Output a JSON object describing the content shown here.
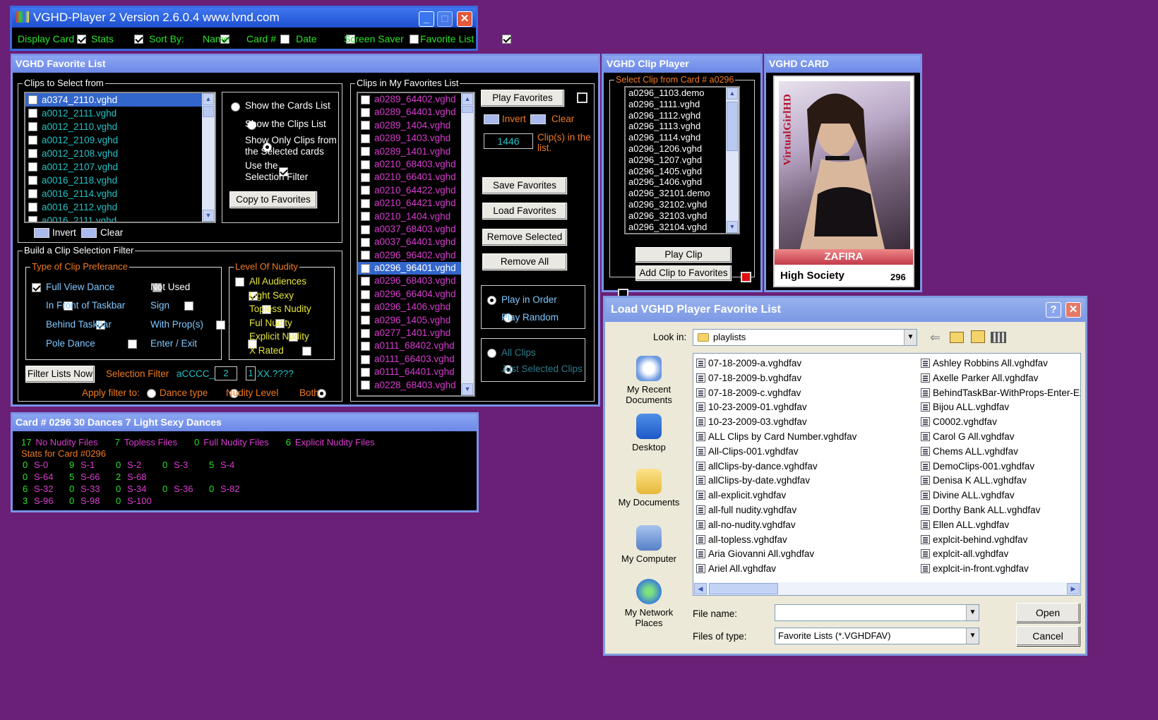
{
  "main_window": {
    "title": "VGHD-Player 2  Version 2.6.0.4  www.lvnd.com",
    "toolbar": {
      "display_card": "Display Card",
      "stats": "Stats",
      "sort_by": "Sort By:",
      "name": "Name",
      "card": "Card #",
      "date": "Date",
      "screen_saver": "Screen Saver",
      "favorite_list": "Favorite List"
    }
  },
  "favorites": {
    "title": "VGHD Favorite List",
    "clips_group": "Clips to Select from",
    "clips": [
      "a0374_2110.vghd",
      "a0012_2111.vghd",
      "a0012_2110.vghd",
      "a0012_2109.vghd",
      "a0012_2108.vghd",
      "a0012_2107.vghd",
      "a0016_2118.vghd",
      "a0016_2114.vghd",
      "a0016_2112.vghd",
      "a0016_2111.vghd"
    ],
    "radio_cards": "Show the Cards List",
    "radio_clips": "Show the Clips List",
    "radio_only_1": "Show Only Clips from",
    "radio_only_2": "the Selected cards",
    "use_1": "Use the",
    "use_2": "Selection Filter",
    "copy_btn": "Copy to Favorites",
    "invert": "Invert",
    "clear": "Clear",
    "filter_group": "Build a Clip Selection Filter",
    "type_group": "Type of Clip Preferance",
    "types": {
      "full_view": "Full View Dance",
      "not_used": "Not Used",
      "in_front": "In Front of Taskbar",
      "sign": "Sign",
      "behind": "Behind Taskbar",
      "with_props": "With Prop(s)",
      "pole": "Pole Dance",
      "enter_exit": "Enter / Exit"
    },
    "nudity_group": "Level Of Nudity",
    "nudity": [
      "All Audiences",
      "Light Sexy",
      "Topless Nudity",
      "Ful Nudity",
      "Explicit Nudity",
      "X Rated"
    ],
    "filter_now": "Filter Lists Now",
    "sel_filter": "Selection Filter",
    "filter_value": "aCCCC_",
    "filter_box1": "2",
    "filter_box2": "1",
    "filter_suffix": "XX.????",
    "apply_to": "Apply filter to:",
    "dance_type": "Dance type",
    "nudity_level": "Nudity Level",
    "both": "Both",
    "fav_group": "Clips in My Favorites List",
    "favs": [
      "a0289_64402.vghd",
      "a0289_64401.vghd",
      "a0289_1404.vghd",
      "a0289_1403.vghd",
      "a0289_1401.vghd",
      "a0210_68403.vghd",
      "a0210_66401.vghd",
      "a0210_64422.vghd",
      "a0210_64421.vghd",
      "a0210_1404.vghd",
      "a0037_68403.vghd",
      "a0037_64401.vghd",
      "a0296_96402.vghd",
      "a0296_96401.vghd",
      "a0296_68403.vghd",
      "a0296_66404.vghd",
      "a0296_1406.vghd",
      "a0296_1405.vghd",
      "a0277_1401.vghd",
      "a0111_68402.vghd",
      "a0111_66403.vghd",
      "a0111_64401.vghd",
      "a0228_68403.vghd"
    ],
    "play_fav": "Play Favorites",
    "invert2": "Invert",
    "clear2": "Clear",
    "count": "1446",
    "count_label": "Clip(s) in the list.",
    "save": "Save Favorites",
    "load": "Load Favorites",
    "remove_sel": "Remove Selected",
    "remove_all": "Remove All",
    "play_order": "Play in Order",
    "play_random": "Play Random",
    "all_clips": "All Clips",
    "just_selected": "Just Selected Clips"
  },
  "stats": {
    "title": "Card # 0296 30 Dances 7 Light Sexy Dances",
    "line1": [
      [
        "17",
        "No Nudity Files"
      ],
      [
        "7",
        "Topless Files"
      ],
      [
        "0",
        "Full Nudity Files"
      ],
      [
        "6",
        "Explicit Nudity Files"
      ]
    ],
    "header": "Stats for Card #0296",
    "rows": [
      [
        [
          "0",
          "S-0"
        ],
        [
          "9",
          "S-1"
        ],
        [
          "0",
          "S-2"
        ],
        [
          "0",
          "S-3"
        ],
        [
          "5",
          "S-4"
        ]
      ],
      [
        [
          "0",
          "S-64"
        ],
        [
          "5",
          "S-66"
        ],
        [
          "2",
          "S-68"
        ]
      ],
      [
        [
          "6",
          "S-32"
        ],
        [
          "0",
          "S-33"
        ],
        [
          "0",
          "S-34"
        ],
        [
          "0",
          "S-36"
        ],
        [
          "0",
          "S-82"
        ]
      ],
      [
        [
          "3",
          "S-96"
        ],
        [
          "0",
          "S-98"
        ],
        [
          "0",
          "S-100"
        ]
      ]
    ]
  },
  "clip_player": {
    "title": "VGHD Clip Player",
    "group": "Select Clip from Card # a0296",
    "clips": [
      "a0296_1103.demo",
      "a0296_1111.vghd",
      "a0296_1112.vghd",
      "a0296_1113.vghd",
      "a0296_1114.vghd",
      "a0296_1206.vghd",
      "a0296_1207.vghd",
      "a0296_1405.vghd",
      "a0296_1406.vghd",
      "a0296_32101.demo",
      "a0296_32102.vghd",
      "a0296_32103.vghd",
      "a0296_32104.vghd"
    ],
    "play": "Play Clip",
    "add": "Add Clip to Favorites"
  },
  "card": {
    "title": "VGHD CARD",
    "brand": "VirtualGirlHD",
    "name": "ZAFIRA",
    "series": "High Society",
    "number": "296"
  },
  "dialog": {
    "title": "Load VGHD Player Favorite List",
    "look_in": "Look in:",
    "folder": "playlists",
    "places": [
      "My Recent Documents",
      "Desktop",
      "My Documents",
      "My Computer",
      "My Network Places"
    ],
    "files_left": [
      "07-18-2009-a.vghdfav",
      "07-18-2009-b.vghdfav",
      "07-18-2009-c.vghdfav",
      "10-23-2009-01.vghdfav",
      "10-23-2009-03.vghdfav",
      "ALL Clips by Card Number.vghdfav",
      "All-Clips-001.vghdfav",
      "allClips-by-dance.vghdfav",
      "allClips-by-date.vghdfav",
      "all-explicit.vghdfav",
      "all-full nudity.vghdfav",
      "all-no-nudity.vghdfav",
      "all-topless.vghdfav",
      "Aria Giovanni All.vghdfav",
      "Ariel All.vghdfav"
    ],
    "files_right": [
      "Ashley Robbins All.vghdfav",
      "Axelle Parker All.vghdfav",
      "BehindTaskBar-WithProps-Enter-Ex",
      "Bijou ALL.vghdfav",
      "C0002.vghdfav",
      "Carol G All.vghdfav",
      "Chems ALL.vghdfav",
      "DemoClips-001.vghdfav",
      "Denisa K ALL.vghdfav",
      "Divine ALL.vghdfav",
      "Dorthy Bank ALL.vghdfav",
      "Ellen ALL.vghdfav",
      "explcit-behind.vghdfav",
      "explcit-all.vghdfav",
      "explcit-in-front.vghdfav"
    ],
    "file_name_label": "File name:",
    "file_name": "",
    "files_of_type_label": "Files of type:",
    "files_of_type": "Favorite Lists (*.VGHDFAV)",
    "open": "Open",
    "cancel": "Cancel"
  }
}
